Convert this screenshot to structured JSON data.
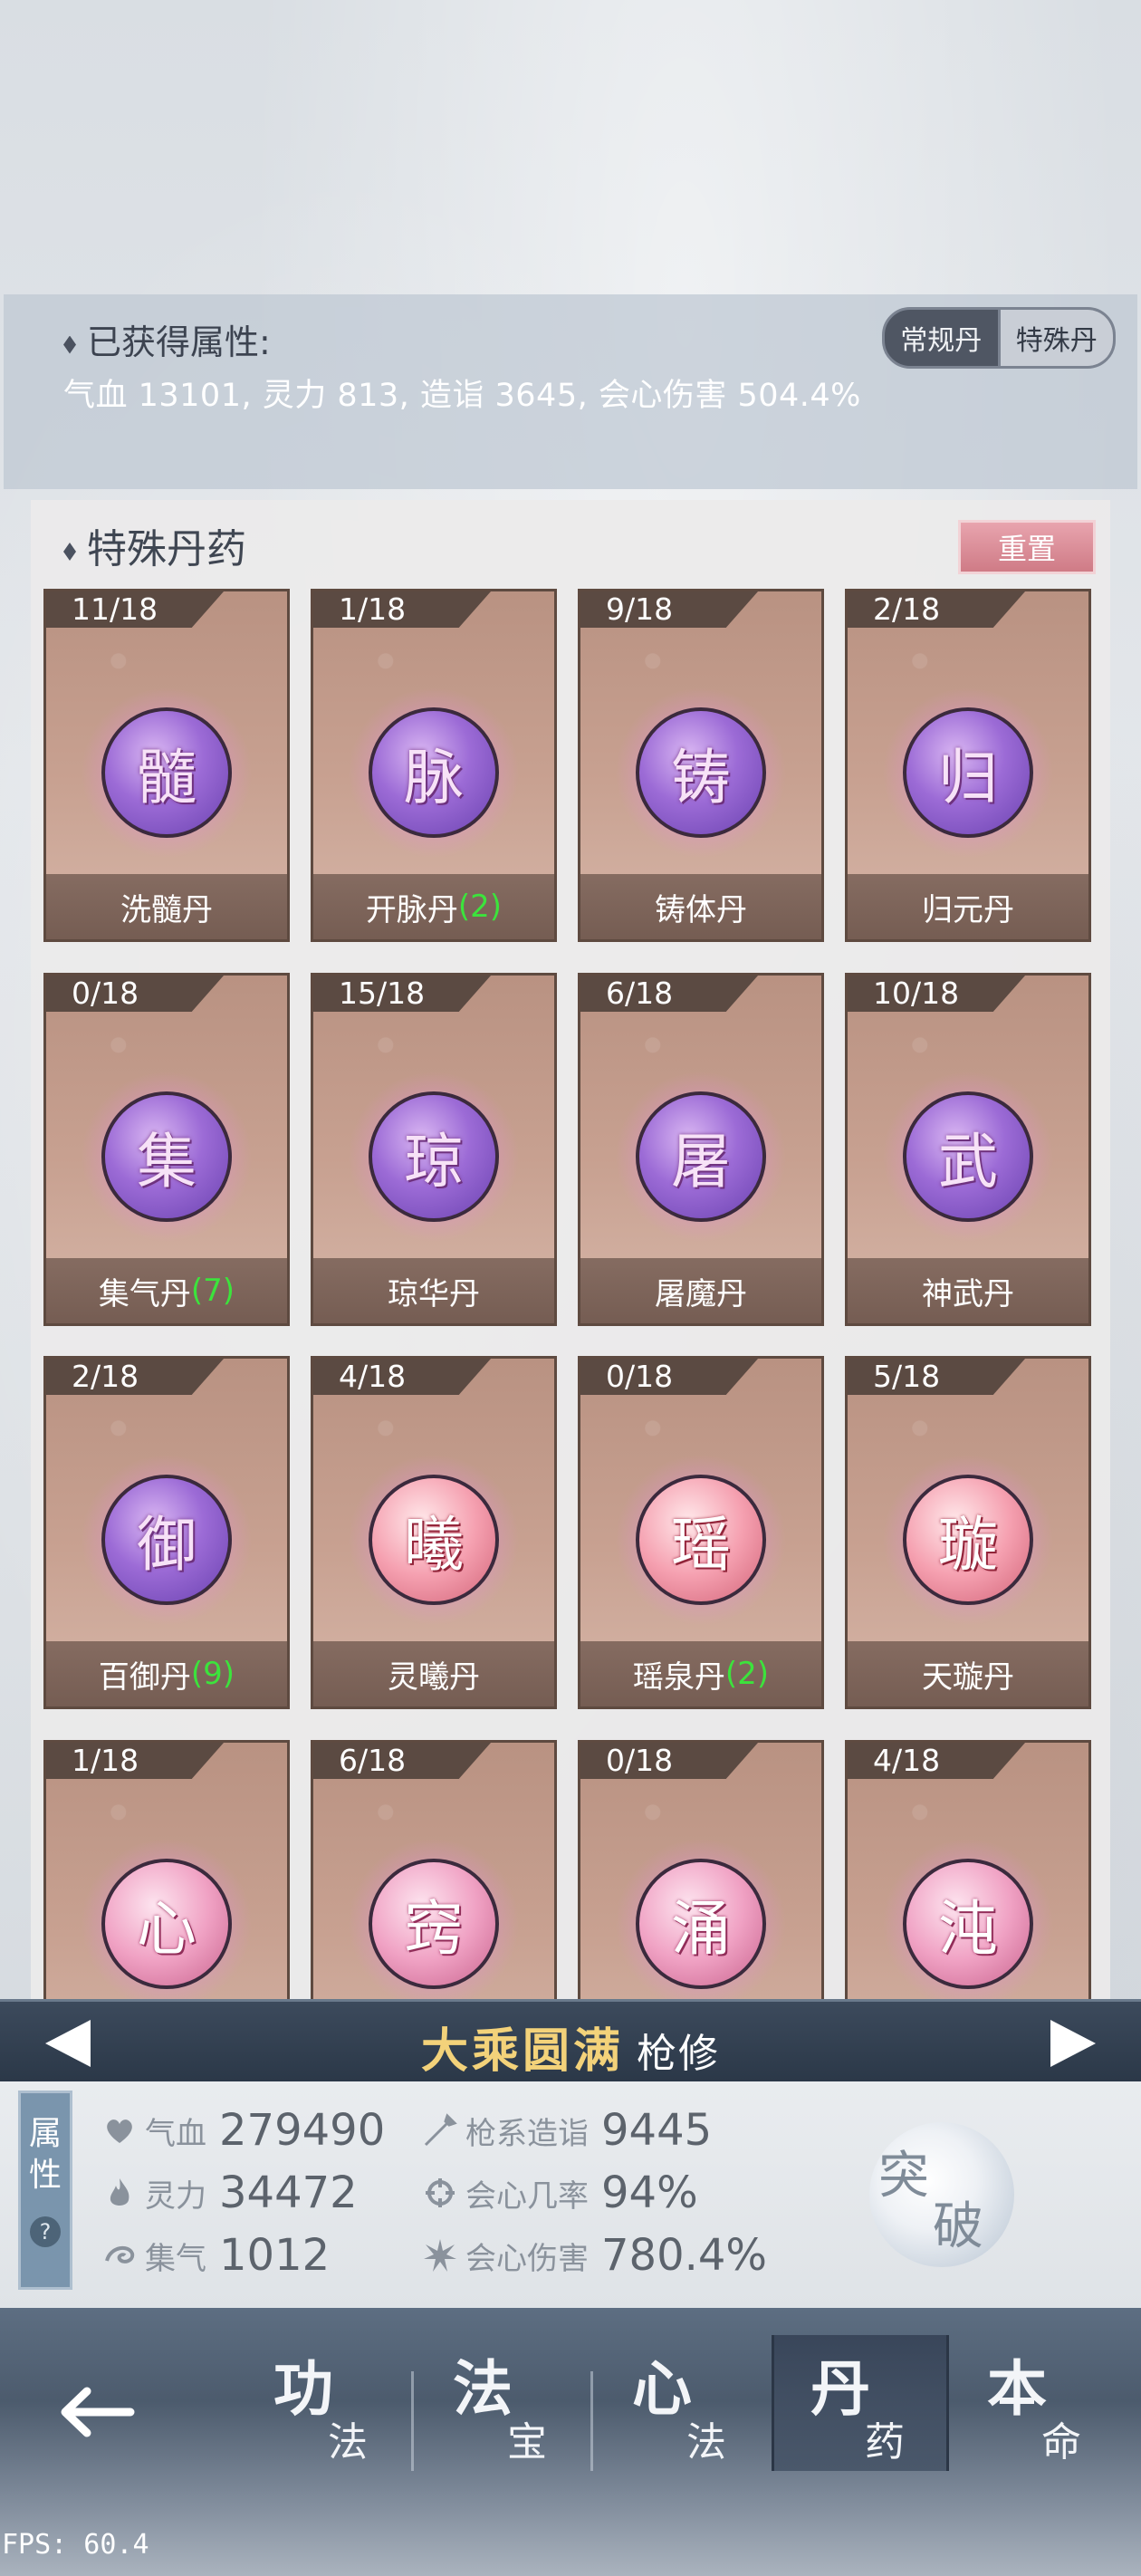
{
  "attributes": {
    "heading": "已获得属性:",
    "summary": "气血 13101, 灵力 813, 造诣 3645, 会心伤害 504.4%",
    "toggle": {
      "left": "常规丹",
      "right": "特殊丹",
      "active": "right"
    }
  },
  "section": {
    "title": "特殊丹药",
    "reset_label": "重置"
  },
  "pills": [
    {
      "count": "11/18",
      "glyph": "髓",
      "name": "洗髓丹",
      "bonus": "",
      "style": "purple"
    },
    {
      "count": "1/18",
      "glyph": "脉",
      "name": "开脉丹",
      "bonus": "(2)",
      "style": "purple"
    },
    {
      "count": "9/18",
      "glyph": "铸",
      "name": "铸体丹",
      "bonus": "",
      "style": "purple"
    },
    {
      "count": "2/18",
      "glyph": "归",
      "name": "归元丹",
      "bonus": "",
      "style": "purple"
    },
    {
      "count": "0/18",
      "glyph": "集",
      "name": "集气丹",
      "bonus": "(7)",
      "style": "purple"
    },
    {
      "count": "15/18",
      "glyph": "琼",
      "name": "琼华丹",
      "bonus": "",
      "style": "purple"
    },
    {
      "count": "6/18",
      "glyph": "屠",
      "name": "屠魔丹",
      "bonus": "",
      "style": "purple"
    },
    {
      "count": "10/18",
      "glyph": "武",
      "name": "神武丹",
      "bonus": "",
      "style": "purple"
    },
    {
      "count": "2/18",
      "glyph": "御",
      "name": "百御丹",
      "bonus": "(9)",
      "style": "purple"
    },
    {
      "count": "4/18",
      "glyph": "曦",
      "name": "灵曦丹",
      "bonus": "",
      "style": "pinkred"
    },
    {
      "count": "0/18",
      "glyph": "瑶",
      "name": "瑶泉丹",
      "bonus": "(2)",
      "style": "pinkred"
    },
    {
      "count": "5/18",
      "glyph": "璇",
      "name": "天璇丹",
      "bonus": "",
      "style": "pinkred"
    },
    {
      "count": "1/18",
      "glyph": "心",
      "name": "",
      "bonus": "",
      "style": "pink"
    },
    {
      "count": "6/18",
      "glyph": "窍",
      "name": "",
      "bonus": "",
      "style": "pink"
    },
    {
      "count": "0/18",
      "glyph": "涌",
      "name": "",
      "bonus": "",
      "style": "pink"
    },
    {
      "count": "4/18",
      "glyph": "沌",
      "name": "",
      "bonus": "",
      "style": "pink"
    }
  ],
  "hero": {
    "realm": "大乘圆满",
    "class": "枪修"
  },
  "stats": {
    "tab_label_1": "属",
    "tab_label_2": "性",
    "help": "?",
    "qixue_label": "气血",
    "qixue_value": "279490",
    "lingli_label": "灵力",
    "lingli_value": "34472",
    "jiqi_label": "集气",
    "jiqi_value": "1012",
    "zaoyi_label": "枪系造诣",
    "zaoyi_value": "9445",
    "crit_rate_label": "会心几率",
    "crit_rate_value": "94%",
    "crit_dmg_label": "会心伤害",
    "crit_dmg_value": "780.4%",
    "breakthrough_1": "突",
    "breakthrough_2": "破"
  },
  "nav": [
    {
      "big": "功",
      "small": "法"
    },
    {
      "big": "法",
      "small": "宝"
    },
    {
      "big": "心",
      "small": "法"
    },
    {
      "big": "丹",
      "small": "药",
      "active": true
    },
    {
      "big": "本",
      "small": "命"
    }
  ],
  "fps": "FPS: 60.4",
  "colors": {
    "bonus_green": "#3ce33c",
    "realm_gold": "#f3d27a",
    "card_bg": "#c8a191"
  }
}
